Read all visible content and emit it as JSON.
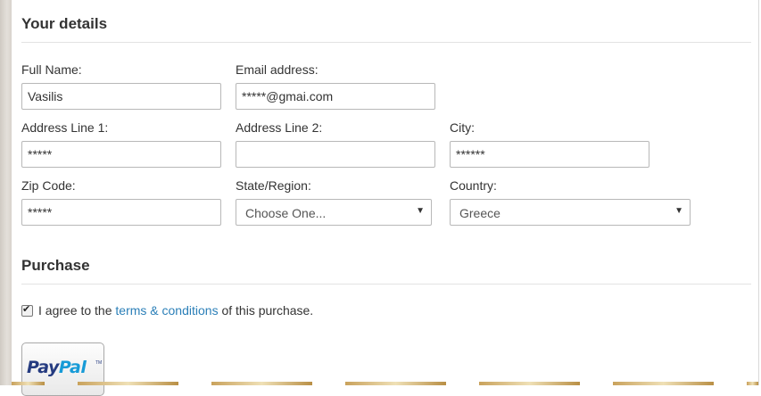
{
  "details": {
    "title": "Your details",
    "full_name": {
      "label": "Full Name:",
      "value": "Vasilis"
    },
    "email": {
      "label": "Email address:",
      "value": "*****@gmai.com"
    },
    "address1": {
      "label": "Address Line 1:",
      "value": "*****"
    },
    "address2": {
      "label": "Address Line 2:",
      "value": ""
    },
    "city": {
      "label": "City:",
      "value": "******"
    },
    "zip": {
      "label": "Zip Code:",
      "value": "*****"
    },
    "state": {
      "label": "State/Region:",
      "selected": "Choose One..."
    },
    "country": {
      "label": "Country:",
      "selected": "Greece"
    }
  },
  "purchase": {
    "title": "Purchase",
    "agree_checked": true,
    "agree_prefix": "I agree to the",
    "terms_link": "terms & conditions",
    "agree_suffix": "of this purchase.",
    "paypal_pay": "Pay",
    "paypal_pal": "Pal",
    "paypal_tm": "TM"
  },
  "colors": {
    "link": "#2b7fb8",
    "paypal_dark": "#253b80",
    "paypal_light": "#179bd7"
  }
}
